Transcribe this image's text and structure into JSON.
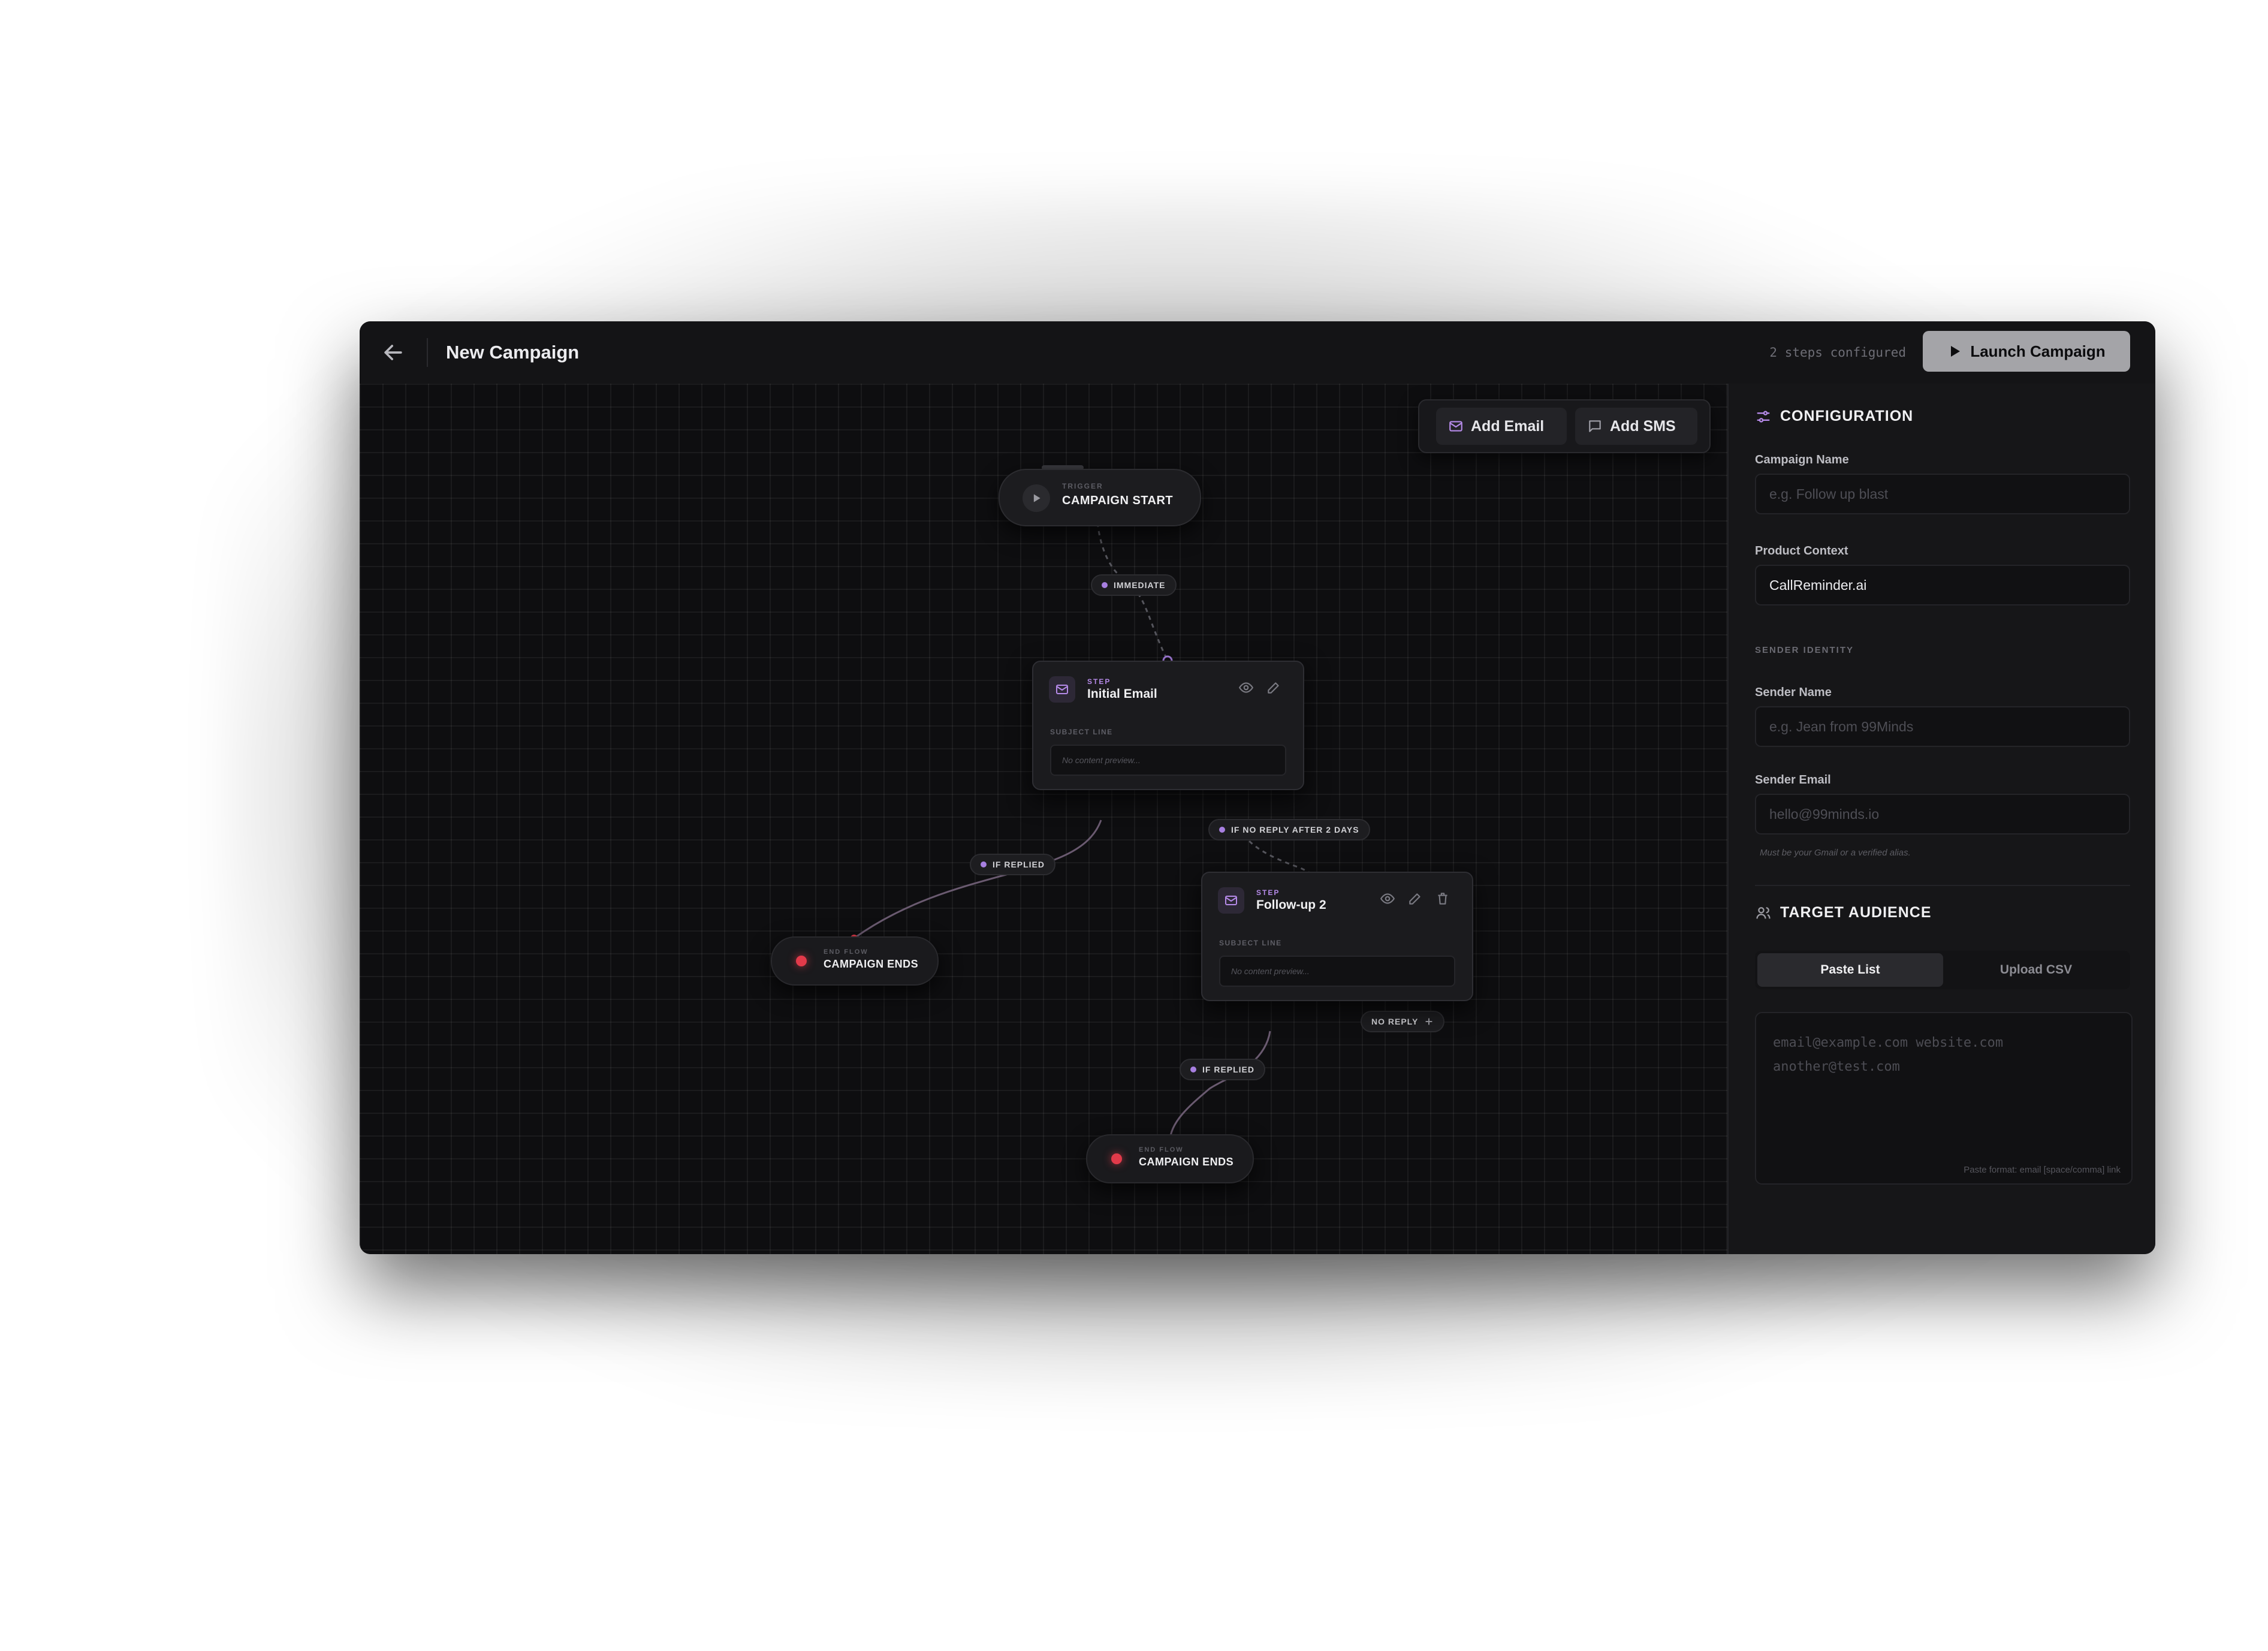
{
  "header": {
    "title": "New Campaign",
    "steps_configured": "2 steps configured",
    "launch_label": "Launch Campaign"
  },
  "toolbar": {
    "add_email": "Add Email",
    "add_sms": "Add SMS"
  },
  "flow": {
    "trigger": {
      "kicker": "TRIGGER",
      "title": "CAMPAIGN START"
    },
    "edge_labels": {
      "immediate": "IMMEDIATE",
      "if_replied_1": "IF REPLIED",
      "no_reply_after": "IF NO REPLY AFTER 2 DAYS",
      "if_replied_2": "IF REPLIED",
      "no_reply": "NO REPLY"
    },
    "steps": [
      {
        "kicker": "STEP",
        "title": "Initial Email",
        "subject_label": "SUBJECT LINE",
        "preview": "No content preview..."
      },
      {
        "kicker": "STEP",
        "title": "Follow-up 2",
        "subject_label": "SUBJECT LINE",
        "preview": "No content preview..."
      }
    ],
    "end_nodes": [
      {
        "kicker": "END FLOW",
        "title": "CAMPAIGN ENDS"
      },
      {
        "kicker": "END FLOW",
        "title": "CAMPAIGN ENDS"
      }
    ]
  },
  "config": {
    "heading": "CONFIGURATION",
    "campaign_name": {
      "label": "Campaign Name",
      "placeholder": "e.g. Follow up blast",
      "value": ""
    },
    "product_context": {
      "label": "Product Context",
      "value": "CallReminder.ai"
    },
    "sender_identity_heading": "SENDER IDENTITY",
    "sender_name": {
      "label": "Sender Name",
      "placeholder": "e.g. Jean from 99Minds"
    },
    "sender_email": {
      "label": "Sender Email",
      "placeholder": "hello@99minds.io",
      "hint": "Must be your Gmail or a verified alias."
    }
  },
  "audience": {
    "heading": "TARGET AUDIENCE",
    "tabs": [
      "Paste List",
      "Upload CSV"
    ],
    "placeholder": "email@example.com website.com\nanother@test.com",
    "format_hint": "Paste format: email [space/comma] link"
  },
  "colors": {
    "accent_purple": "#a77fe0",
    "end_red": "#e23a4a",
    "canvas_bg": "#0e0e10",
    "panel_bg": "#161618"
  }
}
